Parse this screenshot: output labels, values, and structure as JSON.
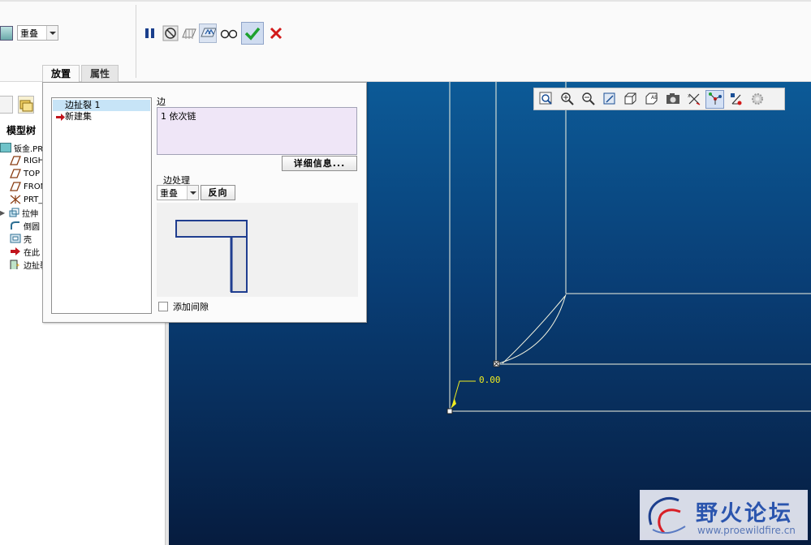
{
  "dashboard": {
    "edge_treatment_value": "重叠",
    "tabs": [
      "放置",
      "属性"
    ]
  },
  "tree": {
    "title": "模型树",
    "items": [
      "钣金.PRT",
      "RIGHT",
      "TOP",
      "FRONT",
      "PRT_CSYS_DEF",
      "拉伸",
      "倒圆",
      "壳",
      "在此",
      "边扯裂"
    ]
  },
  "panel": {
    "sets": [
      "边扯裂 1",
      "新建集"
    ],
    "edge_label": "边",
    "edge_item": "1 依次链",
    "details_button": "详细信息...",
    "edge_treatment_label": "边处理",
    "treatment_value": "重叠",
    "flip_button": "反向",
    "add_gap_label": "添加间隙"
  },
  "graphics": {
    "dimension": "0.00"
  },
  "watermark": {
    "title": "野火论坛",
    "url": "www.proewildfire.cn"
  },
  "colors": {
    "background_top": "#0c5a97",
    "background_bottom": "#061c3f",
    "geometry": "#f4f4e0",
    "dimension": "#f0ec20",
    "confirm": "#1ea12e",
    "cancel": "#d21a1a"
  }
}
